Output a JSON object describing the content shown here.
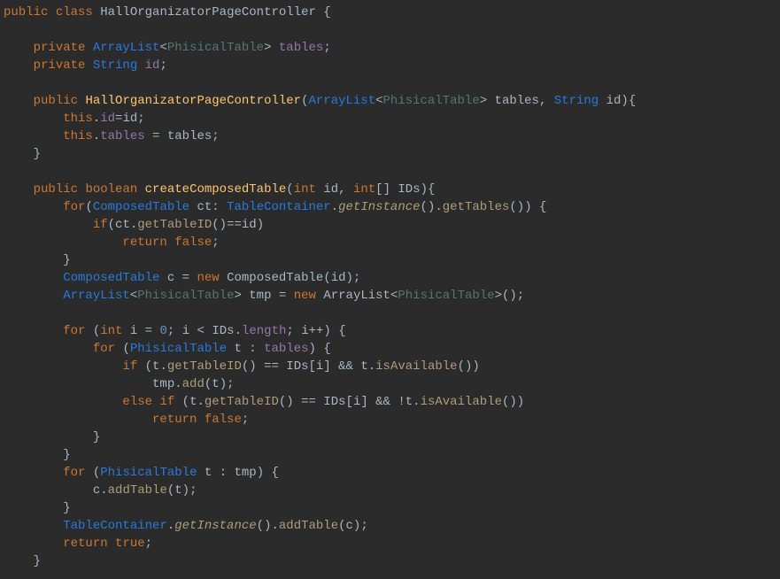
{
  "code": {
    "lines": [
      [
        {
          "cls": "kw",
          "t": "public"
        },
        {
          "cls": "punct",
          "t": " "
        },
        {
          "cls": "kw",
          "t": "class"
        },
        {
          "cls": "punct",
          "t": " "
        },
        {
          "cls": "typename",
          "t": "HallOrganizatorPageController"
        },
        {
          "cls": "punct",
          "t": " {"
        }
      ],
      [],
      [
        {
          "cls": "punct",
          "t": "    "
        },
        {
          "cls": "kw",
          "t": "private"
        },
        {
          "cls": "punct",
          "t": " "
        },
        {
          "cls": "type",
          "t": "ArrayList"
        },
        {
          "cls": "punct",
          "t": "<"
        },
        {
          "cls": "typegen",
          "t": "PhisicalTable"
        },
        {
          "cls": "punct",
          "t": "> "
        },
        {
          "cls": "field",
          "t": "tables"
        },
        {
          "cls": "punct",
          "t": ";"
        }
      ],
      [
        {
          "cls": "punct",
          "t": "    "
        },
        {
          "cls": "kw",
          "t": "private"
        },
        {
          "cls": "punct",
          "t": " "
        },
        {
          "cls": "type",
          "t": "String"
        },
        {
          "cls": "punct",
          "t": " "
        },
        {
          "cls": "field",
          "t": "id"
        },
        {
          "cls": "punct",
          "t": ";"
        }
      ],
      [],
      [
        {
          "cls": "punct",
          "t": "    "
        },
        {
          "cls": "kw",
          "t": "public"
        },
        {
          "cls": "punct",
          "t": " "
        },
        {
          "cls": "method-def",
          "t": "HallOrganizatorPageController"
        },
        {
          "cls": "punct",
          "t": "("
        },
        {
          "cls": "type",
          "t": "ArrayList"
        },
        {
          "cls": "punct",
          "t": "<"
        },
        {
          "cls": "typegen",
          "t": "PhisicalTable"
        },
        {
          "cls": "punct",
          "t": "> "
        },
        {
          "cls": "var",
          "t": "tables"
        },
        {
          "cls": "punct",
          "t": ", "
        },
        {
          "cls": "type",
          "t": "String"
        },
        {
          "cls": "punct",
          "t": " "
        },
        {
          "cls": "var",
          "t": "id"
        },
        {
          "cls": "punct",
          "t": "){"
        }
      ],
      [
        {
          "cls": "punct",
          "t": "        "
        },
        {
          "cls": "kw",
          "t": "this"
        },
        {
          "cls": "punct",
          "t": "."
        },
        {
          "cls": "field",
          "t": "id"
        },
        {
          "cls": "punct",
          "t": "="
        },
        {
          "cls": "var",
          "t": "id"
        },
        {
          "cls": "punct",
          "t": ";"
        }
      ],
      [
        {
          "cls": "punct",
          "t": "        "
        },
        {
          "cls": "kw",
          "t": "this"
        },
        {
          "cls": "punct",
          "t": "."
        },
        {
          "cls": "field",
          "t": "tables"
        },
        {
          "cls": "punct",
          "t": " = "
        },
        {
          "cls": "var",
          "t": "tables"
        },
        {
          "cls": "punct",
          "t": ";"
        }
      ],
      [
        {
          "cls": "punct",
          "t": "    }"
        }
      ],
      [],
      [
        {
          "cls": "punct",
          "t": "    "
        },
        {
          "cls": "kw",
          "t": "public"
        },
        {
          "cls": "punct",
          "t": " "
        },
        {
          "cls": "kw",
          "t": "boolean"
        },
        {
          "cls": "punct",
          "t": " "
        },
        {
          "cls": "method-def",
          "t": "createComposedTable"
        },
        {
          "cls": "punct",
          "t": "("
        },
        {
          "cls": "kw",
          "t": "int"
        },
        {
          "cls": "punct",
          "t": " "
        },
        {
          "cls": "var",
          "t": "id"
        },
        {
          "cls": "punct",
          "t": ", "
        },
        {
          "cls": "kw",
          "t": "int"
        },
        {
          "cls": "punct",
          "t": "[] "
        },
        {
          "cls": "var",
          "t": "IDs"
        },
        {
          "cls": "punct",
          "t": "){"
        }
      ],
      [
        {
          "cls": "punct",
          "t": "        "
        },
        {
          "cls": "kw",
          "t": "for"
        },
        {
          "cls": "punct",
          "t": "("
        },
        {
          "cls": "type",
          "t": "ComposedTable"
        },
        {
          "cls": "punct",
          "t": " "
        },
        {
          "cls": "var",
          "t": "ct"
        },
        {
          "cls": "punct",
          "t": ": "
        },
        {
          "cls": "type",
          "t": "TableContainer"
        },
        {
          "cls": "punct",
          "t": "."
        },
        {
          "cls": "method-italic",
          "t": "getInstance"
        },
        {
          "cls": "punct",
          "t": "()."
        },
        {
          "cls": "method-call",
          "t": "getTables"
        },
        {
          "cls": "punct",
          "t": "()) {"
        }
      ],
      [
        {
          "cls": "punct",
          "t": "            "
        },
        {
          "cls": "kw",
          "t": "if"
        },
        {
          "cls": "punct",
          "t": "("
        },
        {
          "cls": "var",
          "t": "ct"
        },
        {
          "cls": "punct",
          "t": "."
        },
        {
          "cls": "method-call",
          "t": "getTableID"
        },
        {
          "cls": "punct",
          "t": "()=="
        },
        {
          "cls": "var",
          "t": "id"
        },
        {
          "cls": "punct",
          "t": ")"
        }
      ],
      [
        {
          "cls": "punct",
          "t": "                "
        },
        {
          "cls": "kw",
          "t": "return"
        },
        {
          "cls": "punct",
          "t": " "
        },
        {
          "cls": "kw",
          "t": "false"
        },
        {
          "cls": "punct",
          "t": ";"
        }
      ],
      [
        {
          "cls": "punct",
          "t": "        }"
        }
      ],
      [
        {
          "cls": "punct",
          "t": "        "
        },
        {
          "cls": "type",
          "t": "ComposedTable"
        },
        {
          "cls": "punct",
          "t": " "
        },
        {
          "cls": "var",
          "t": "c"
        },
        {
          "cls": "punct",
          "t": " = "
        },
        {
          "cls": "kw",
          "t": "new"
        },
        {
          "cls": "punct",
          "t": " "
        },
        {
          "cls": "var",
          "t": "ComposedTable"
        },
        {
          "cls": "punct",
          "t": "("
        },
        {
          "cls": "var",
          "t": "id"
        },
        {
          "cls": "punct",
          "t": ");"
        }
      ],
      [
        {
          "cls": "punct",
          "t": "        "
        },
        {
          "cls": "type",
          "t": "ArrayList"
        },
        {
          "cls": "punct",
          "t": "<"
        },
        {
          "cls": "typegen",
          "t": "PhisicalTable"
        },
        {
          "cls": "punct",
          "t": "> "
        },
        {
          "cls": "var",
          "t": "tmp"
        },
        {
          "cls": "punct",
          "t": " = "
        },
        {
          "cls": "kw",
          "t": "new"
        },
        {
          "cls": "punct",
          "t": " "
        },
        {
          "cls": "var",
          "t": "ArrayList"
        },
        {
          "cls": "punct",
          "t": "<"
        },
        {
          "cls": "typegen",
          "t": "PhisicalTable"
        },
        {
          "cls": "punct",
          "t": ">();"
        }
      ],
      [],
      [
        {
          "cls": "punct",
          "t": "        "
        },
        {
          "cls": "kw",
          "t": "for"
        },
        {
          "cls": "punct",
          "t": " ("
        },
        {
          "cls": "kw",
          "t": "int"
        },
        {
          "cls": "punct",
          "t": " "
        },
        {
          "cls": "var",
          "t": "i"
        },
        {
          "cls": "punct",
          "t": " = "
        },
        {
          "cls": "num",
          "t": "0"
        },
        {
          "cls": "punct",
          "t": "; "
        },
        {
          "cls": "var",
          "t": "i"
        },
        {
          "cls": "punct",
          "t": " < "
        },
        {
          "cls": "var",
          "t": "IDs"
        },
        {
          "cls": "punct",
          "t": "."
        },
        {
          "cls": "field",
          "t": "length"
        },
        {
          "cls": "punct",
          "t": "; "
        },
        {
          "cls": "var",
          "t": "i"
        },
        {
          "cls": "punct",
          "t": "++) {"
        }
      ],
      [
        {
          "cls": "punct",
          "t": "            "
        },
        {
          "cls": "kw",
          "t": "for"
        },
        {
          "cls": "punct",
          "t": " ("
        },
        {
          "cls": "type",
          "t": "PhisicalTable"
        },
        {
          "cls": "punct",
          "t": " "
        },
        {
          "cls": "var",
          "t": "t"
        },
        {
          "cls": "punct",
          "t": " : "
        },
        {
          "cls": "field",
          "t": "tables"
        },
        {
          "cls": "punct",
          "t": ") {"
        }
      ],
      [
        {
          "cls": "punct",
          "t": "                "
        },
        {
          "cls": "kw",
          "t": "if"
        },
        {
          "cls": "punct",
          "t": " ("
        },
        {
          "cls": "var",
          "t": "t"
        },
        {
          "cls": "punct",
          "t": "."
        },
        {
          "cls": "method-call",
          "t": "getTableID"
        },
        {
          "cls": "punct",
          "t": "() == "
        },
        {
          "cls": "var",
          "t": "IDs"
        },
        {
          "cls": "punct",
          "t": "["
        },
        {
          "cls": "var",
          "t": "i"
        },
        {
          "cls": "punct",
          "t": "] && "
        },
        {
          "cls": "var",
          "t": "t"
        },
        {
          "cls": "punct",
          "t": "."
        },
        {
          "cls": "method-call",
          "t": "isAvailable"
        },
        {
          "cls": "punct",
          "t": "())"
        }
      ],
      [
        {
          "cls": "punct",
          "t": "                    "
        },
        {
          "cls": "var",
          "t": "tmp"
        },
        {
          "cls": "punct",
          "t": "."
        },
        {
          "cls": "method-call",
          "t": "add"
        },
        {
          "cls": "punct",
          "t": "("
        },
        {
          "cls": "var",
          "t": "t"
        },
        {
          "cls": "punct",
          "t": ");"
        }
      ],
      [
        {
          "cls": "punct",
          "t": "                "
        },
        {
          "cls": "kw",
          "t": "else"
        },
        {
          "cls": "punct",
          "t": " "
        },
        {
          "cls": "kw",
          "t": "if"
        },
        {
          "cls": "punct",
          "t": " ("
        },
        {
          "cls": "var",
          "t": "t"
        },
        {
          "cls": "punct",
          "t": "."
        },
        {
          "cls": "method-call",
          "t": "getTableID"
        },
        {
          "cls": "punct",
          "t": "() == "
        },
        {
          "cls": "var",
          "t": "IDs"
        },
        {
          "cls": "punct",
          "t": "["
        },
        {
          "cls": "var",
          "t": "i"
        },
        {
          "cls": "punct",
          "t": "] && !"
        },
        {
          "cls": "var",
          "t": "t"
        },
        {
          "cls": "punct",
          "t": "."
        },
        {
          "cls": "method-call",
          "t": "isAvailable"
        },
        {
          "cls": "punct",
          "t": "())"
        }
      ],
      [
        {
          "cls": "punct",
          "t": "                    "
        },
        {
          "cls": "kw",
          "t": "return"
        },
        {
          "cls": "punct",
          "t": " "
        },
        {
          "cls": "kw",
          "t": "false"
        },
        {
          "cls": "punct",
          "t": ";"
        }
      ],
      [
        {
          "cls": "punct",
          "t": "            }"
        }
      ],
      [
        {
          "cls": "punct",
          "t": "        }"
        }
      ],
      [
        {
          "cls": "punct",
          "t": "        "
        },
        {
          "cls": "kw",
          "t": "for"
        },
        {
          "cls": "punct",
          "t": " ("
        },
        {
          "cls": "type",
          "t": "PhisicalTable"
        },
        {
          "cls": "punct",
          "t": " "
        },
        {
          "cls": "var",
          "t": "t"
        },
        {
          "cls": "punct",
          "t": " : "
        },
        {
          "cls": "var",
          "t": "tmp"
        },
        {
          "cls": "punct",
          "t": ") {"
        }
      ],
      [
        {
          "cls": "punct",
          "t": "            "
        },
        {
          "cls": "var",
          "t": "c"
        },
        {
          "cls": "punct",
          "t": "."
        },
        {
          "cls": "method-call",
          "t": "addTable"
        },
        {
          "cls": "punct",
          "t": "("
        },
        {
          "cls": "var",
          "t": "t"
        },
        {
          "cls": "punct",
          "t": ");"
        }
      ],
      [
        {
          "cls": "punct",
          "t": "        }"
        }
      ],
      [
        {
          "cls": "punct",
          "t": "        "
        },
        {
          "cls": "type",
          "t": "TableContainer"
        },
        {
          "cls": "punct",
          "t": "."
        },
        {
          "cls": "method-italic",
          "t": "getInstance"
        },
        {
          "cls": "punct",
          "t": "()."
        },
        {
          "cls": "method-call",
          "t": "addTable"
        },
        {
          "cls": "punct",
          "t": "("
        },
        {
          "cls": "var",
          "t": "c"
        },
        {
          "cls": "punct",
          "t": ");"
        }
      ],
      [
        {
          "cls": "punct",
          "t": "        "
        },
        {
          "cls": "kw",
          "t": "return"
        },
        {
          "cls": "punct",
          "t": " "
        },
        {
          "cls": "kw",
          "t": "true"
        },
        {
          "cls": "punct",
          "t": ";"
        }
      ],
      [
        {
          "cls": "punct",
          "t": "    }"
        }
      ]
    ]
  }
}
